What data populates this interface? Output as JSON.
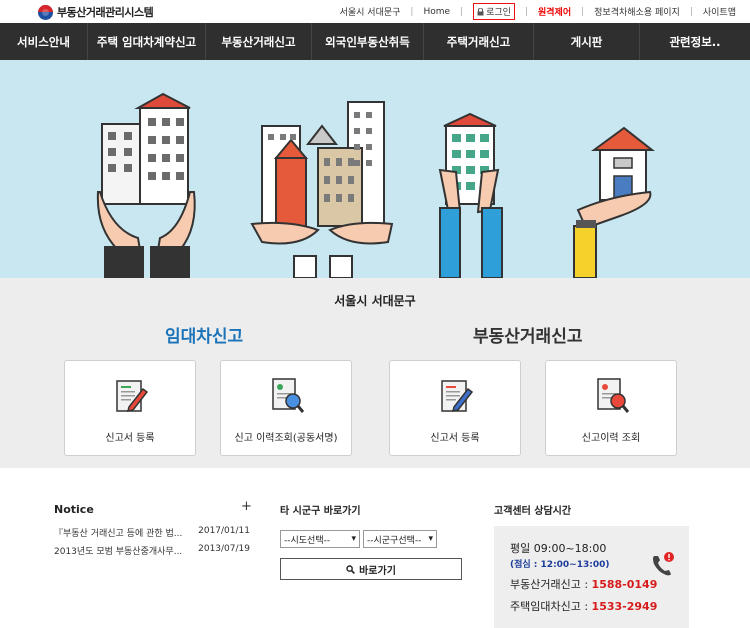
{
  "header": {
    "logo_text": "부동산거래관리시스템",
    "links": {
      "region": "서울시 서대문구",
      "home": "Home",
      "login": "로그인",
      "remote": "원격제어",
      "accessibility": "정보격차해소용 페이지",
      "sitemap": "사이트맵"
    }
  },
  "nav": {
    "items": [
      {
        "label": "서비스안내"
      },
      {
        "label": "주택 임대차계약신고"
      },
      {
        "label": "부동산거래신고"
      },
      {
        "label": "외국인부동산취득"
      },
      {
        "label": "주택거래신고"
      },
      {
        "label": "게시판"
      },
      {
        "label": "관련정보.."
      }
    ]
  },
  "services": {
    "region": "서울시 서대문구",
    "lease_title": "임대차신고",
    "trade_title": "부동산거래신고",
    "cards": [
      {
        "label": "신고서 등록"
      },
      {
        "label": "신고 이력조회(공동서명)"
      },
      {
        "label": "신고서 등록"
      },
      {
        "label": "신고이력 조회"
      }
    ]
  },
  "notice": {
    "title": "Notice",
    "more": "+",
    "items": [
      {
        "title": "『부동산 거래신고 등에 관한 법...",
        "date": "2017/01/11"
      },
      {
        "title": "2013년도 모범 부동산중개사무...",
        "date": "2013/07/19"
      }
    ]
  },
  "shortcut": {
    "title": "타 시군구 바로가기",
    "sido_placeholder": "--시도선택--",
    "sigungu_placeholder": "--시군구선택--",
    "go_label": "바로가기"
  },
  "support": {
    "title": "고객센터 상담시간",
    "hours": "평일 09:00~18:00",
    "lunch": "(점심 : 12:00~13:00)",
    "trade_label": "부동산거래신고 : ",
    "trade_phone": "1588-0149",
    "lease_label": "주택임대차신고 : ",
    "lease_phone": "1533-2949"
  }
}
